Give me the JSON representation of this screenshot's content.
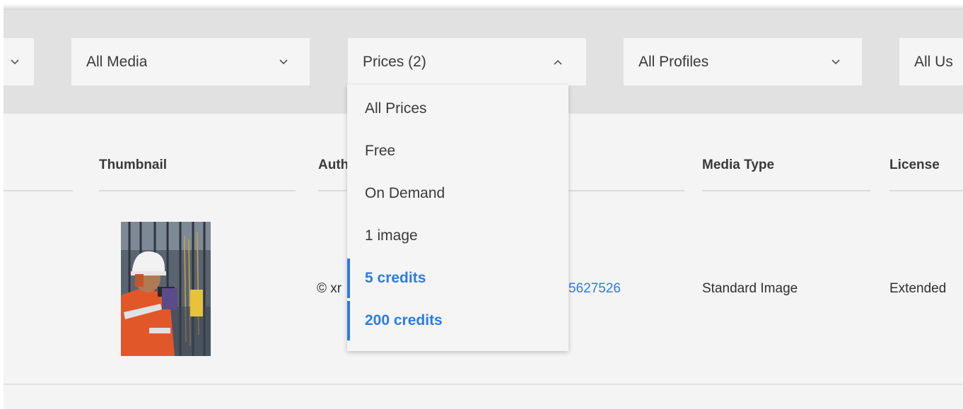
{
  "filters": [
    {
      "label": ""
    },
    {
      "label": "All Media"
    },
    {
      "label": "Prices (2)"
    },
    {
      "label": "All Profiles"
    },
    {
      "label": "All Us"
    }
  ],
  "price_dropdown": {
    "options": [
      {
        "label": "All Prices",
        "selected": false
      },
      {
        "label": "Free",
        "selected": false
      },
      {
        "label": "On Demand",
        "selected": false
      },
      {
        "label": "1 image",
        "selected": false
      },
      {
        "label": "5 credits",
        "selected": true
      },
      {
        "label": "200 credits",
        "selected": true
      }
    ]
  },
  "table": {
    "headers": {
      "thumbnail": "Thumbnail",
      "author": "Auth",
      "media_type": "Media Type",
      "license": "License"
    },
    "row": {
      "author": "© xr",
      "id": "5627526",
      "media_type": "Standard Image",
      "license": "Extended"
    }
  },
  "colors": {
    "accent": "#2d7be5",
    "filter_bar": "#e1e1e1",
    "background": "#f4f4f4"
  }
}
